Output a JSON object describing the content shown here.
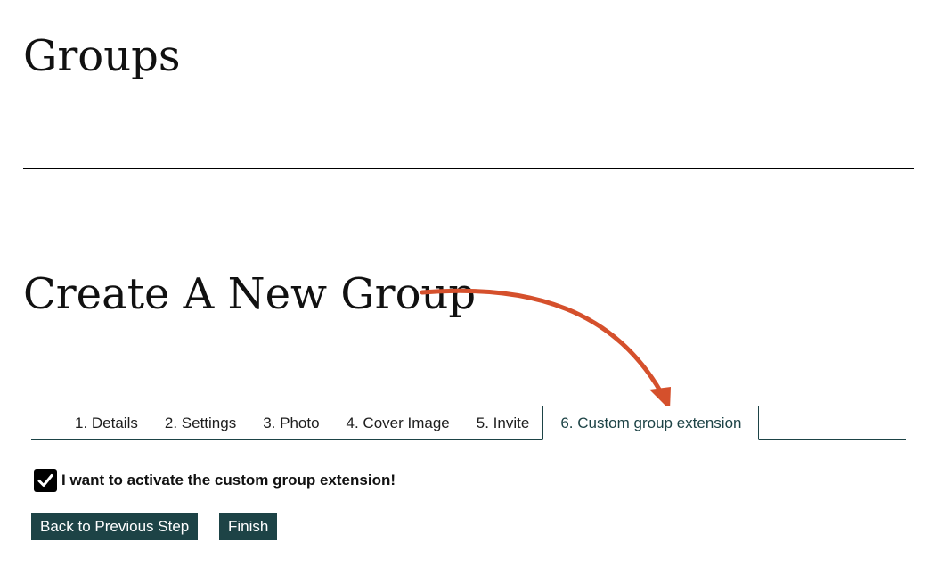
{
  "header": {
    "title": "Groups"
  },
  "create": {
    "title": "Create A New Group"
  },
  "tabs": [
    {
      "label": "1. Details",
      "active": false
    },
    {
      "label": "2. Settings",
      "active": false
    },
    {
      "label": "3. Photo",
      "active": false
    },
    {
      "label": "4. Cover Image",
      "active": false
    },
    {
      "label": "5. Invite",
      "active": false
    },
    {
      "label": "6. Custom group extension",
      "active": true
    }
  ],
  "form": {
    "checkbox_label": "I want to activate the custom group extension!",
    "checkbox_checked": true
  },
  "buttons": {
    "back_label": "Back to Previous Step",
    "finish_label": "Finish"
  },
  "colors": {
    "accent": "#1d4346",
    "annotation_arrow": "#d5502c"
  },
  "icons": {
    "checkbox": "checkmark-icon",
    "annotation": "curved-arrow-icon"
  }
}
